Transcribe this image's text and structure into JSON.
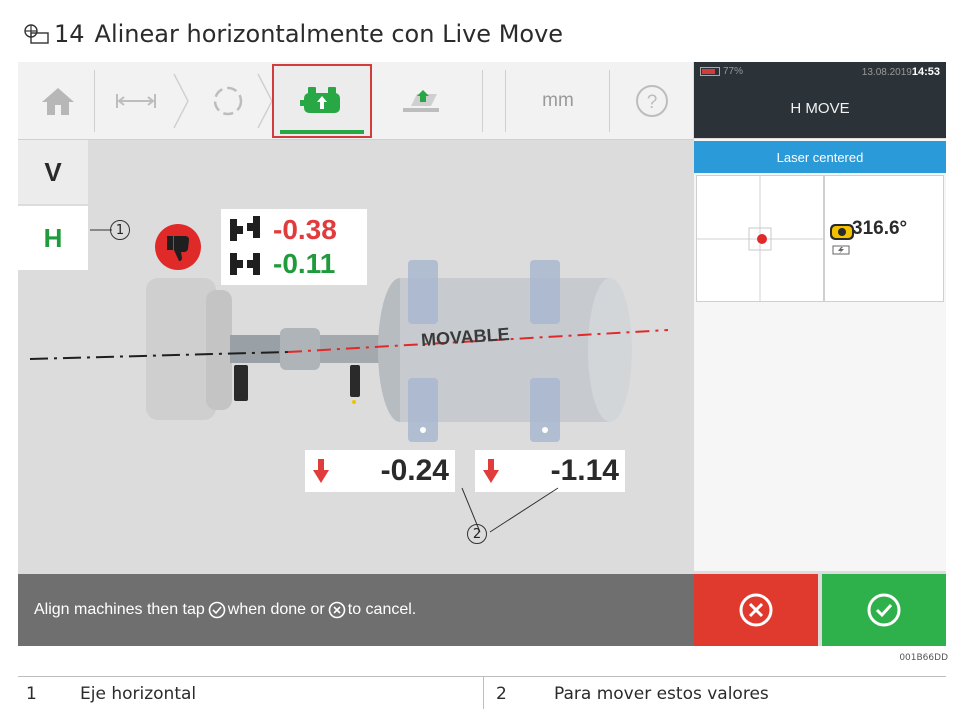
{
  "document": {
    "figure_number": "14",
    "title": "Alinear horizontalmente con Live Move",
    "image_code": "001B66DD"
  },
  "toolbar": {
    "unit": "mm",
    "items": [
      "home-icon",
      "dimensions-icon",
      "measure-icon",
      "move-icon",
      "results-icon",
      "help-icon"
    ],
    "active": "move-icon",
    "active_accent": "#27a844",
    "highlight_color": "#d23c3c"
  },
  "status": {
    "battery": "77%",
    "date": "13.08.2019",
    "time": "14:53",
    "mode_title": "H MOVE"
  },
  "right_panel": {
    "laser_status": "Laser centered",
    "angle": "316.6°"
  },
  "side_tabs": {
    "v_label": "V",
    "h_label": "H"
  },
  "coupling": {
    "offset_value": "-0.38",
    "gap_value": "-0.11",
    "offset_color": "#e03c3c",
    "gap_color": "#1f9a3c",
    "status_icon": "thumbs-down-icon"
  },
  "machine": {
    "label": "MOVABLE"
  },
  "feet": {
    "front_value": "-0.24",
    "back_value": "-1.14"
  },
  "bottom_bar": {
    "text_before": "Align machines then tap",
    "text_middle": "when done or",
    "text_after": "to cancel."
  },
  "callouts": [
    "1",
    "2"
  ],
  "legend": [
    {
      "number": "1",
      "text": "Eje horizontal"
    },
    {
      "number": "2",
      "text": "Para mover estos valores"
    }
  ]
}
